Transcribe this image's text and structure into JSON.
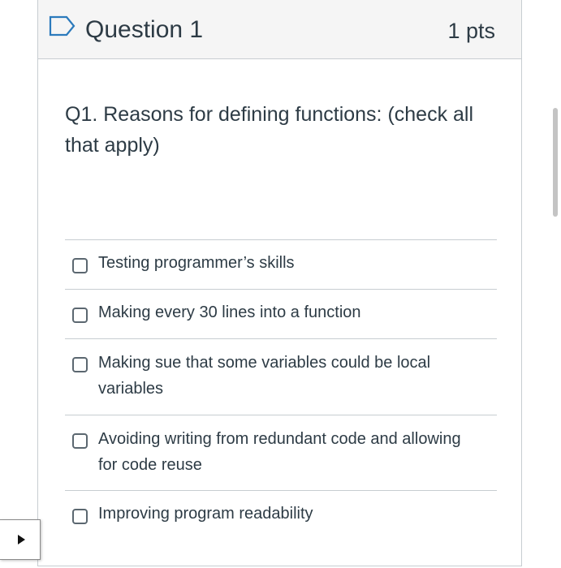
{
  "question": {
    "title": "Question 1",
    "points": "1 pts",
    "text": "Q1. Reasons for defining functions: (check all that apply)",
    "answers": [
      {
        "label": "Testing programmer’s skills",
        "checked": false
      },
      {
        "label": "Making every 30 lines into a function",
        "checked": false
      },
      {
        "label": "Making sue that some variables could be local variables",
        "checked": false
      },
      {
        "label": "Avoiding writing from redundant code and allowing for code reuse",
        "checked": false
      },
      {
        "label": "Improving program readability",
        "checked": false
      }
    ]
  },
  "icons": {
    "flag": "flag-icon",
    "play": "play-icon"
  },
  "colors": {
    "accent": "#2b7abc",
    "text": "#2d3b45",
    "header_bg": "#f5f5f5",
    "border": "#c7cdd1"
  }
}
